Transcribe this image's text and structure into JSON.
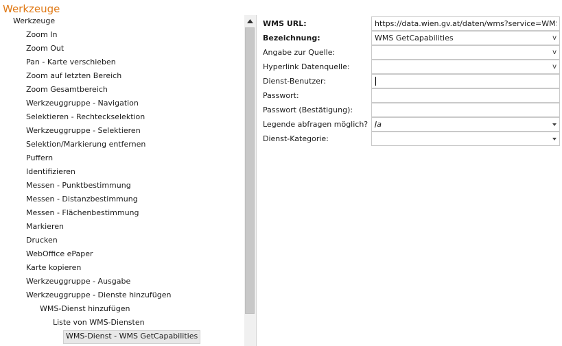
{
  "title": "Werkzeuge",
  "tree": {
    "items": [
      {
        "label": "Werkzeuge",
        "level": 0
      },
      {
        "label": "Zoom In",
        "level": 1
      },
      {
        "label": "Zoom Out",
        "level": 1
      },
      {
        "label": "Pan - Karte verschieben",
        "level": 1
      },
      {
        "label": "Zoom auf letzten Bereich",
        "level": 1
      },
      {
        "label": "Zoom Gesamtbereich",
        "level": 1
      },
      {
        "label": "Werkzeuggruppe - Navigation",
        "level": 1
      },
      {
        "label": "Selektieren - Rechteckselektion",
        "level": 1
      },
      {
        "label": "Werkzeuggruppe - Selektieren",
        "level": 1
      },
      {
        "label": "Selektion/Markierung entfernen",
        "level": 1
      },
      {
        "label": "Puffern",
        "level": 1
      },
      {
        "label": "Identifizieren",
        "level": 1
      },
      {
        "label": "Messen - Punktbestimmung",
        "level": 1
      },
      {
        "label": "Messen - Distanzbestimmung",
        "level": 1
      },
      {
        "label": "Messen - Flächenbestimmung",
        "level": 1
      },
      {
        "label": "Markieren",
        "level": 1
      },
      {
        "label": "Drucken",
        "level": 1
      },
      {
        "label": "WebOffice ePaper",
        "level": 1
      },
      {
        "label": "Karte kopieren",
        "level": 1
      },
      {
        "label": "Werkzeuggruppe - Ausgabe",
        "level": 1
      },
      {
        "label": "Werkzeuggruppe - Dienste hinzufügen",
        "level": 1
      },
      {
        "label": "WMS-Dienst hinzufügen",
        "level": 2
      },
      {
        "label": "Liste von WMS-Diensten",
        "level": 3
      },
      {
        "label": "WMS-Dienst - WMS GetCapabilities",
        "level": 4,
        "selected": true
      }
    ]
  },
  "properties": [
    {
      "label": "WMS URL:",
      "bold": true,
      "value": "https://data.wien.gv.at/daten/wms?service=WMS&re",
      "control": "text"
    },
    {
      "label": "Bezeichnung:",
      "bold": true,
      "value": "WMS GetCapabilities",
      "control": "v-dropdown"
    },
    {
      "label": "Angabe zur Quelle:",
      "bold": false,
      "value": "",
      "control": "v-dropdown"
    },
    {
      "label": "Hyperlink Datenquelle:",
      "bold": false,
      "value": "",
      "control": "v-dropdown"
    },
    {
      "label": "Dienst-Benutzer:",
      "bold": false,
      "value": "",
      "control": "text-focused"
    },
    {
      "label": "Passwort:",
      "bold": false,
      "value": "",
      "control": "text"
    },
    {
      "label": "Passwort (Bestätigung):",
      "bold": false,
      "value": "",
      "control": "text"
    },
    {
      "label": "Legende abfragen möglich?",
      "bold": false,
      "value": "Ja",
      "control": "select"
    },
    {
      "label": "Dienst-Kategorie:",
      "bold": false,
      "value": "",
      "control": "select"
    }
  ],
  "dropdown_glyph": "v",
  "colors": {
    "title": "#e07a17",
    "selected_bg": "#e8e8e8"
  },
  "icons": {
    "scroll_up": "triangle-up-icon",
    "select_arrow": "chevron-down-icon"
  }
}
